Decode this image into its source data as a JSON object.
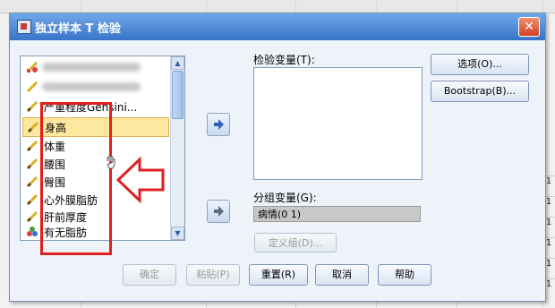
{
  "dialog": {
    "title": "独立样本 T 检验",
    "close_symbol": "✕"
  },
  "variables": {
    "items": [
      {
        "label": "",
        "blurred": true
      },
      {
        "label": "",
        "blurred": true
      },
      {
        "label": "严重程度Gensini..."
      },
      {
        "label": "身高",
        "selected": true
      },
      {
        "label": "体重"
      },
      {
        "label": "腰围"
      },
      {
        "label": "臀围"
      },
      {
        "label": "心外膜脂肪"
      },
      {
        "label": "肝前厚度"
      },
      {
        "label": "有无脂肪"
      }
    ]
  },
  "test_variable": {
    "label": "检验变量(T):"
  },
  "group_variable": {
    "label": "分组变量(G):",
    "value": "病情(0 1)"
  },
  "buttons": {
    "options": "选项(O)...",
    "bootstrap": "Bootstrap(B)...",
    "define_groups": "定义组(D)...",
    "ok": "确定",
    "paste": "粘贴(P)",
    "reset": "重置(R)",
    "cancel": "取消",
    "help": "帮助"
  },
  "background": {
    "row_values": [
      "1",
      "1",
      "1",
      "1",
      "1",
      "1"
    ]
  },
  "colors": {
    "highlight_border": "#e02020",
    "title_bar": "#3a74c8",
    "selected_row": "#fde8a0"
  },
  "icons": {
    "variable": "ruler-pencil-icon",
    "move_right": "right-arrow-icon"
  }
}
